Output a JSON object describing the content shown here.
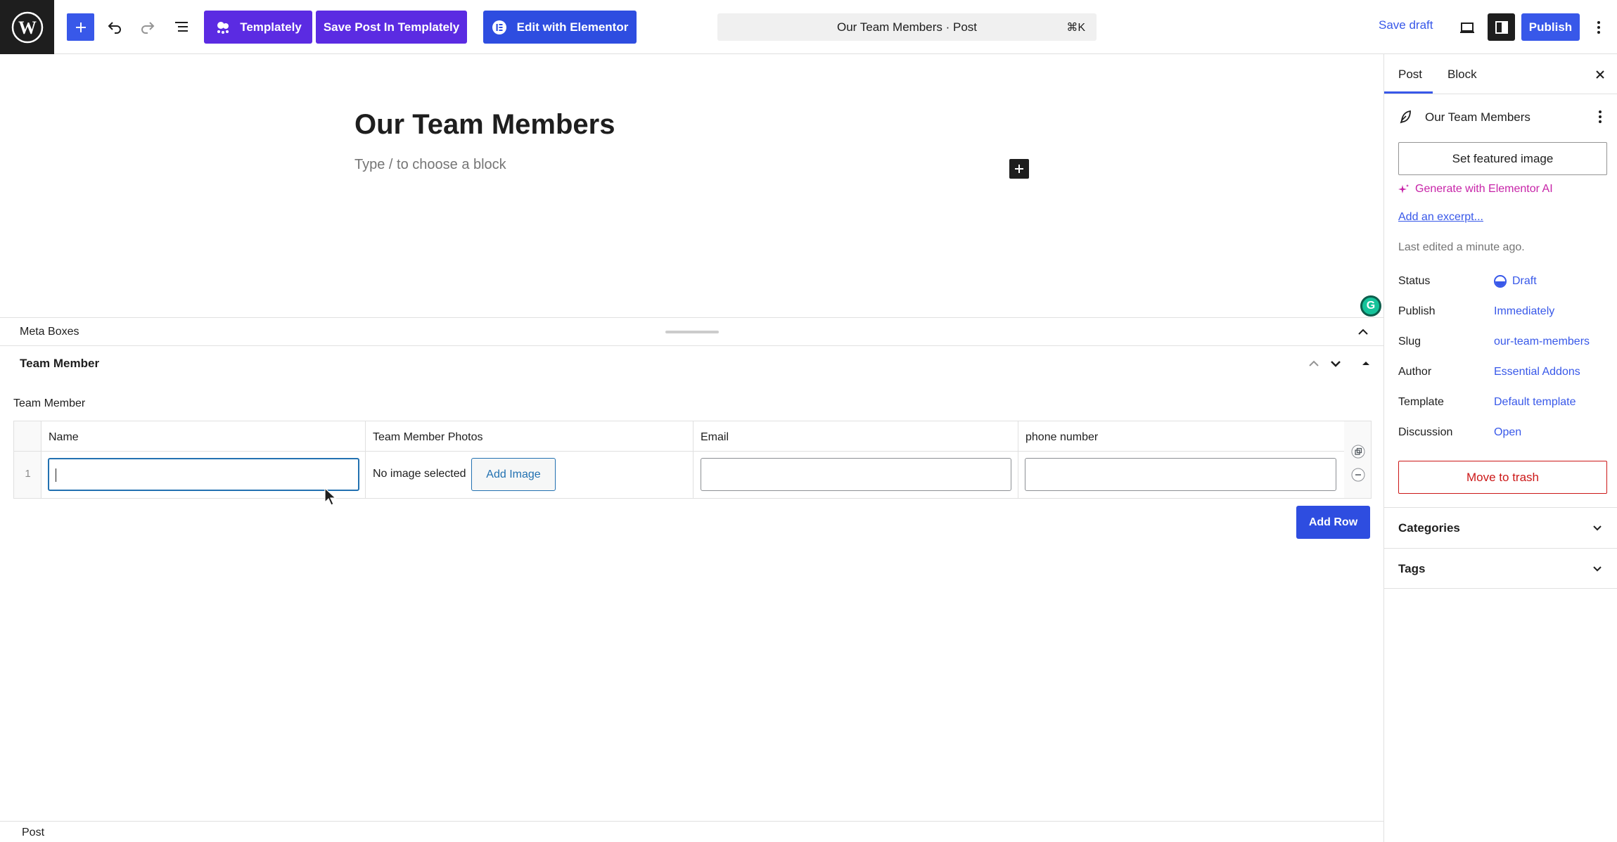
{
  "toolbar": {
    "templately_label": "Templately",
    "save_templately_label": "Save Post In Templately",
    "elementor_label": "Edit with Elementor",
    "command_bar_text": "Our Team Members · Post",
    "command_shortcut": "⌘K",
    "save_draft_label": "Save draft",
    "publish_label": "Publish"
  },
  "editor": {
    "post_title": "Our Team Members",
    "block_placeholder": "Type / to choose a block"
  },
  "meta_boxes": {
    "header_label": "Meta Boxes",
    "team_member_box": {
      "title": "Team Member",
      "field_label": "Team Member",
      "columns": [
        "Name",
        "Team Member Photos",
        "Email",
        "phone number"
      ],
      "rows": [
        {
          "number": "1",
          "name": "",
          "photo_status": "No image selected",
          "add_image_label": "Add Image",
          "email": "",
          "phone": ""
        }
      ],
      "add_row_label": "Add Row"
    }
  },
  "footer": {
    "breadcrumb": "Post"
  },
  "sidebar": {
    "tabs": [
      "Post",
      "Block"
    ],
    "active_tab": "Post",
    "post_title": "Our Team Members",
    "featured_image_label": "Set featured image",
    "generate_ai_label": "Generate with Elementor AI",
    "excerpt_link": "Add an excerpt...",
    "last_edited": "Last edited a minute ago.",
    "summary": [
      {
        "label": "Status",
        "value": "Draft"
      },
      {
        "label": "Publish",
        "value": "Immediately"
      },
      {
        "label": "Slug",
        "value": "our-team-members"
      },
      {
        "label": "Author",
        "value": "Essential Addons"
      },
      {
        "label": "Template",
        "value": "Default template"
      },
      {
        "label": "Discussion",
        "value": "Open"
      }
    ],
    "trash_label": "Move to trash",
    "panels": [
      "Categories",
      "Tags"
    ]
  },
  "colors": {
    "accent": "#3858e9",
    "templately_purple": "#5b2be2",
    "elementor_blue": "#2e4de0",
    "danger": "#cc1818",
    "ai_magenta": "#c724a8"
  }
}
